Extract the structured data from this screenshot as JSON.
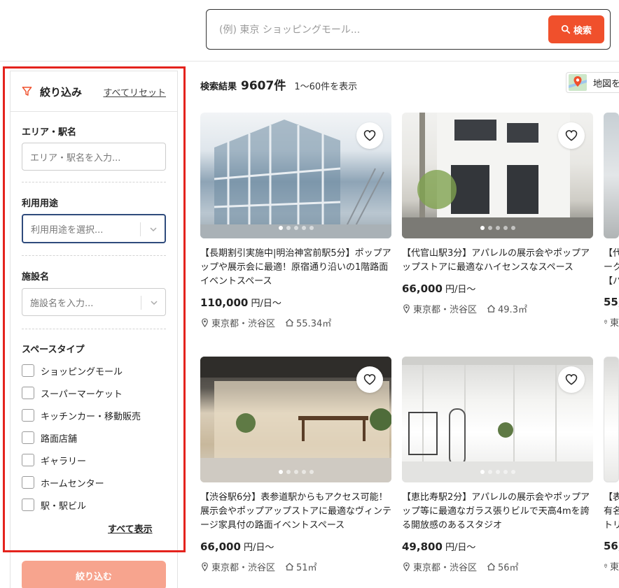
{
  "search": {
    "placeholder": "(例) 東京 ショッピングモール...",
    "button_label": "検索"
  },
  "sidebar": {
    "title": "絞り込み",
    "reset_label": "すべてリセット",
    "area": {
      "label": "エリア・駅名",
      "placeholder": "エリア・駅名を入力..."
    },
    "usage": {
      "label": "利用用途",
      "placeholder": "利用用途を選択..."
    },
    "facility": {
      "label": "施設名",
      "placeholder": "施設名を入力..."
    },
    "space_type": {
      "label": "スペースタイプ",
      "options": [
        "ショッピングモール",
        "スーパーマーケット",
        "キッチンカー・移動販売",
        "路面店舗",
        "ギャラリー",
        "ホームセンター",
        "駅・駅ビル"
      ],
      "show_all_label": "すべて表示"
    },
    "submit_label": "絞り込む"
  },
  "results": {
    "label": "検索結果",
    "count": "9607件",
    "range": "1〜60件を表示",
    "map_label": "地図を"
  },
  "cards": [
    {
      "title": "【長期割引実施中|明治神宮前駅5分】ポップアップや展示会に最適！原宿通り沿いの1階路面イベントスペース",
      "price": "110,000",
      "price_unit": "円/日〜",
      "location": "東京都・渋谷区",
      "area": "55.34㎡"
    },
    {
      "title": "【代官山駅3分】アパレルの展示会やポップアップストアに最適なハイセンスなスペース",
      "price": "66,000",
      "price_unit": "円/日〜",
      "location": "東京都・渋谷区",
      "area": "49.3㎡"
    },
    {
      "title": "【渋谷駅6分】表参道駅からもアクセス可能！展示会やポップアップストアに最適なヴィンテージ家具付の路面イベントスペース",
      "price": "66,000",
      "price_unit": "円/日〜",
      "location": "東京都・渋谷区",
      "area": "51㎡"
    },
    {
      "title": "【恵比寿駅2分】アパレルの展示会やポップアップ等に最適なガラス張りビルで天高4mを誇る開放感のあるスタジオ",
      "price": "49,800",
      "price_unit": "円/日〜",
      "location": "東京都・渋谷区",
      "area": "56㎡"
    },
    {
      "title": "【代\nーク\n【ハ",
      "price": "55,",
      "price_unit": "",
      "location": "東",
      "area": ""
    },
    {
      "title": "【表\n有名\nトリ",
      "price": "56,",
      "price_unit": "",
      "location": "東",
      "area": ""
    }
  ],
  "colors": {
    "accent": "#f0502c",
    "highlight_frame": "#e4231d",
    "submit_disabled": "#f7a48e",
    "focus_border": "#2f4b7c"
  }
}
